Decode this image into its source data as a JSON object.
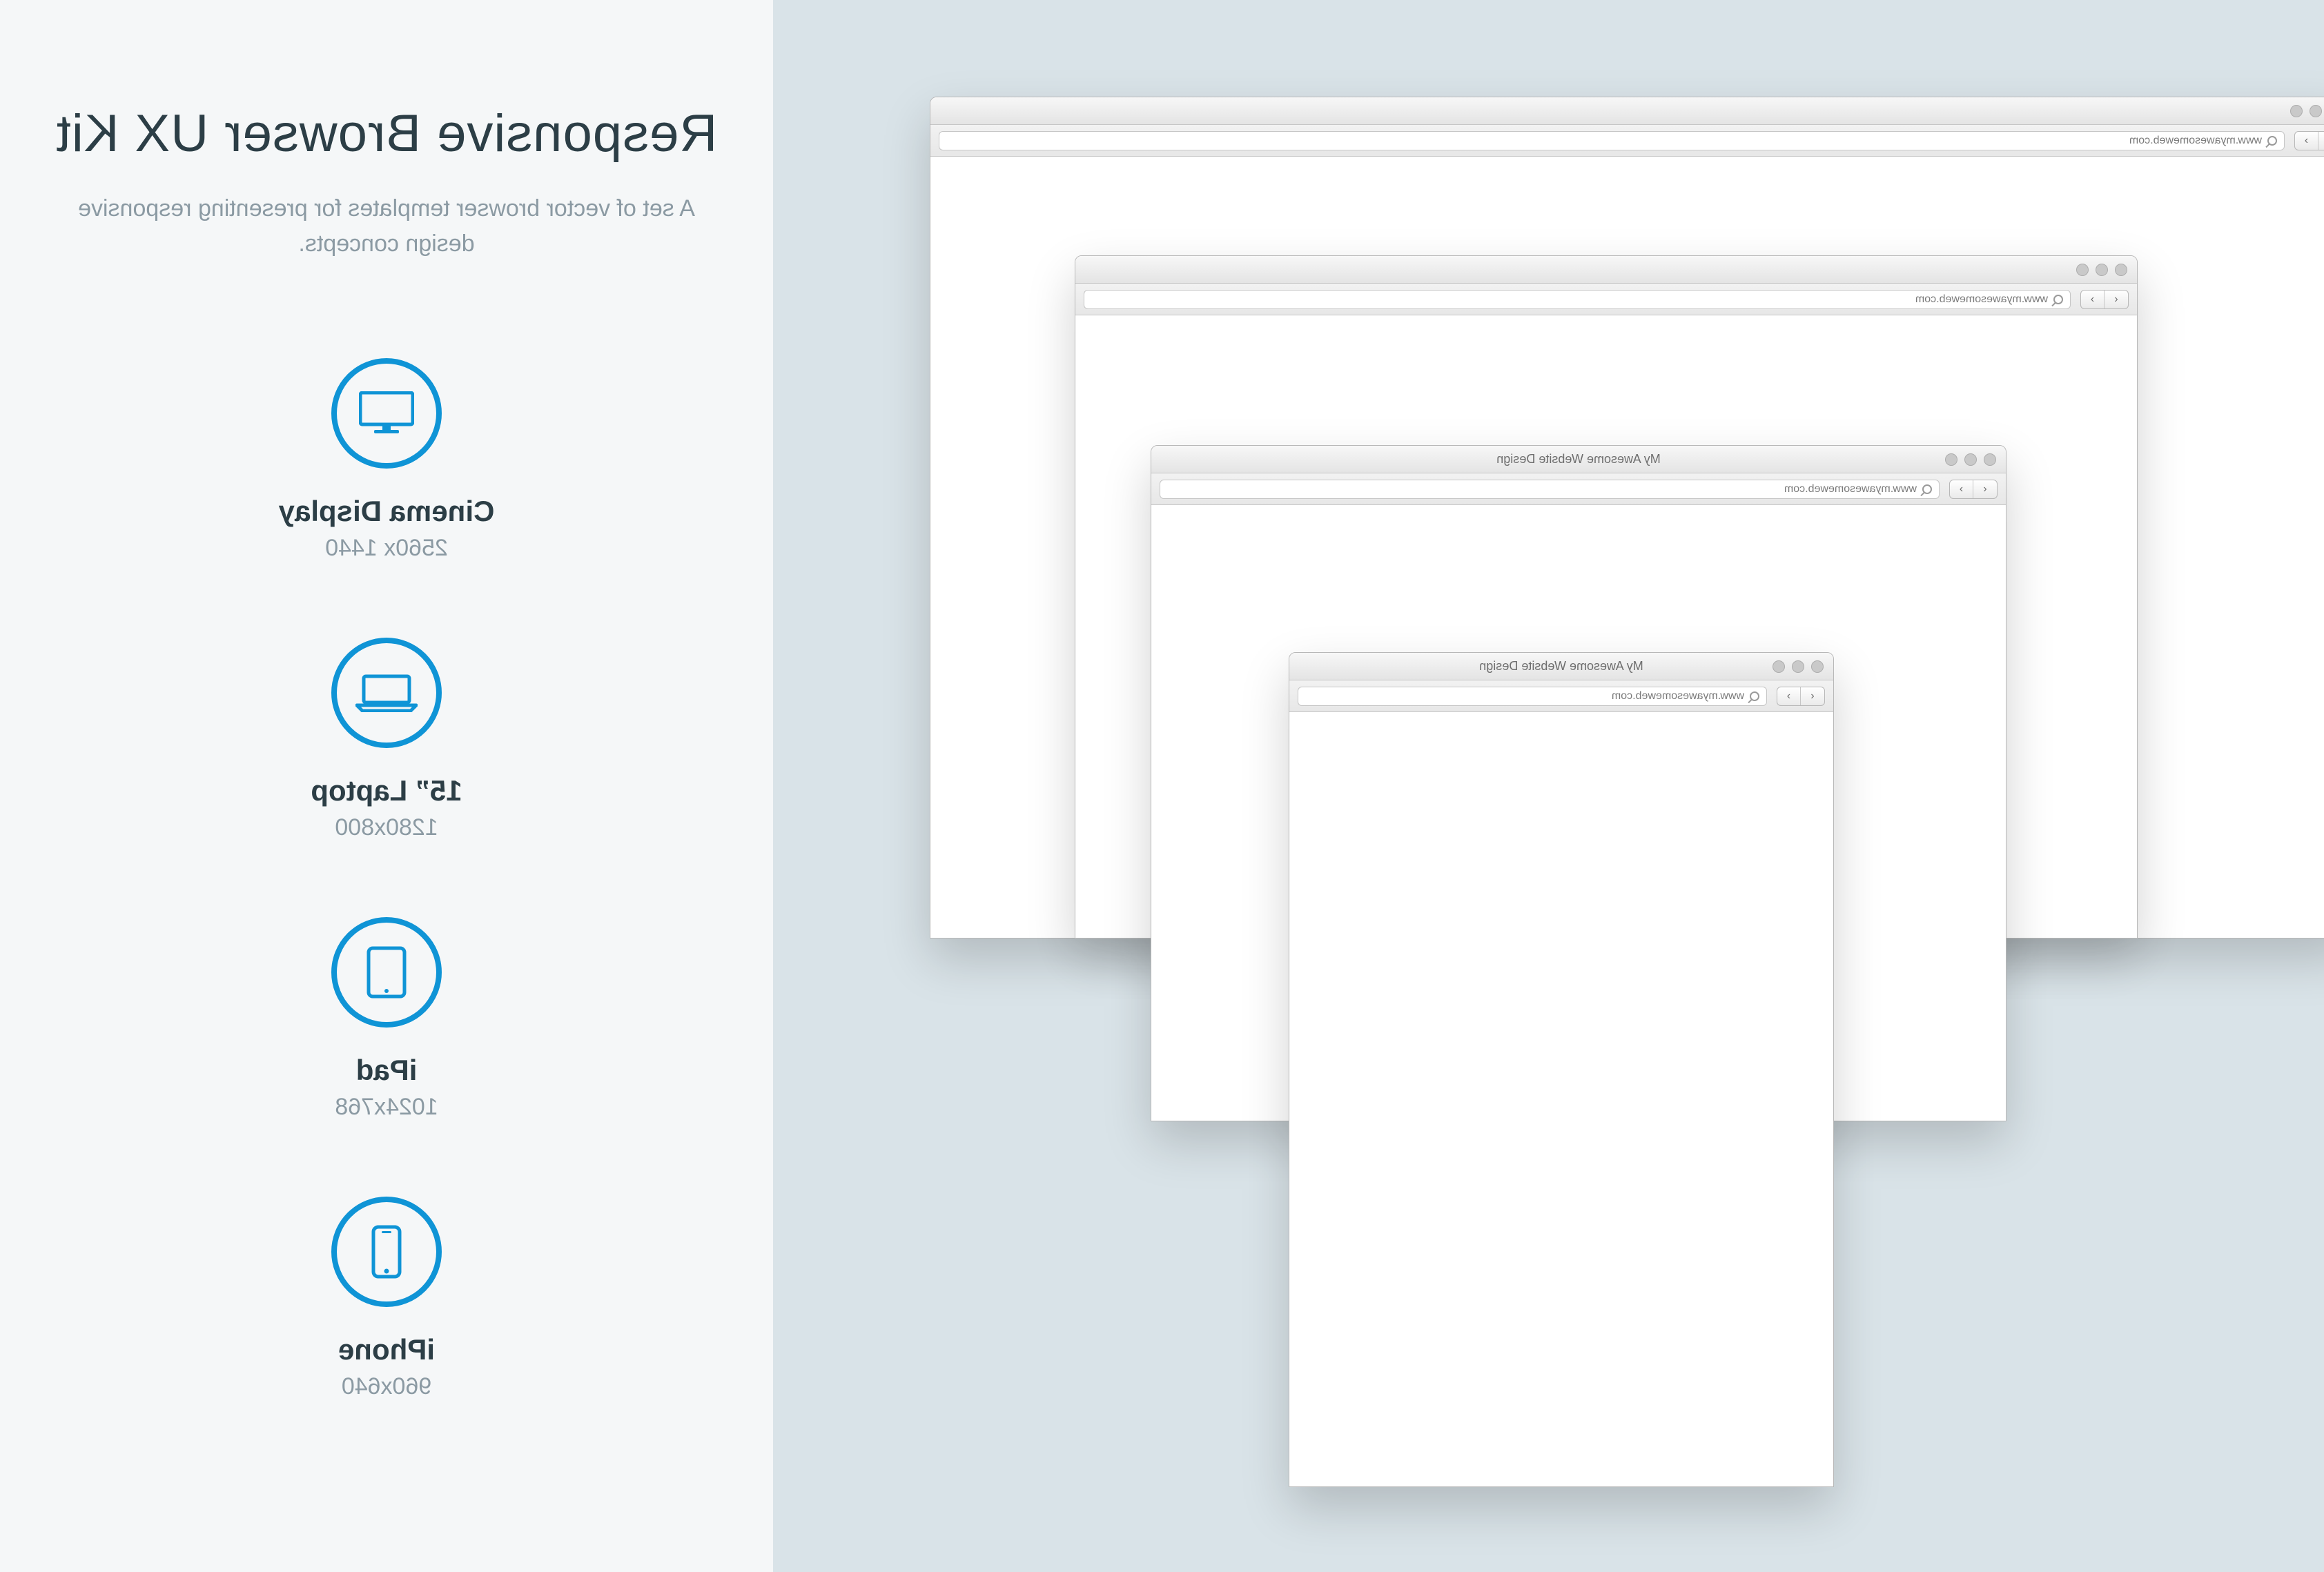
{
  "panel": {
    "title": "Responsive Browser UX Kit",
    "subtitle": "A set of vector browser templates for presenting responsive design concepts.",
    "accent": "#0f94d6"
  },
  "devices": [
    {
      "id": "cinema",
      "name": "Cinema Display",
      "resolution": "2560x 1440"
    },
    {
      "id": "laptop",
      "name": "15” Laptop",
      "resolution": "1280x800"
    },
    {
      "id": "ipad",
      "name": "iPad",
      "resolution": "1024x768"
    },
    {
      "id": "iphone",
      "name": "iPhone",
      "resolution": "960x640"
    }
  ],
  "browsers": {
    "cinema": {
      "tab_title": "",
      "url": "www.myawesomeweb.com"
    },
    "laptop": {
      "tab_title": "",
      "url": "www.myawesomeweb.com"
    },
    "ipad": {
      "tab_title": "My Awesome Website Design",
      "url": "www.myawesomeweb.com"
    },
    "iphone": {
      "tab_title": "My Awesome Website Design",
      "url": "www.myawesomeweb.com"
    }
  },
  "nav": {
    "back": "‹",
    "forward": "›"
  }
}
